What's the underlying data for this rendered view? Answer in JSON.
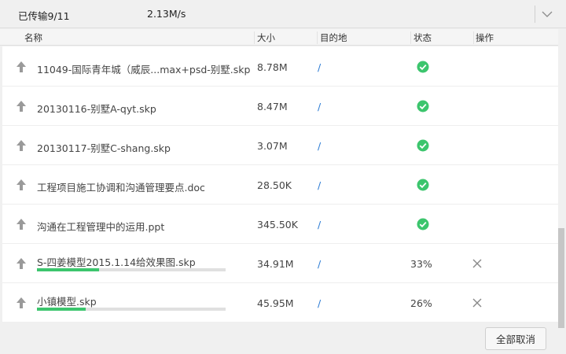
{
  "topbar": {
    "transferred": "已传输9/11",
    "speed": "2.13M/s",
    "collapse_icon": "chevron-down-icon"
  },
  "columns": {
    "name": "名称",
    "size": "大小",
    "destination": "目的地",
    "status": "状态",
    "action": "操作"
  },
  "rows": [
    {
      "name": "11049-国际青年城（威辰...max+psd-别墅.skp",
      "size": "8.78M",
      "dest": "/",
      "status": "done",
      "status_icon": "check-circle-icon"
    },
    {
      "name": "20130116-别墅A-qyt.skp",
      "size": "8.47M",
      "dest": "/",
      "status": "done",
      "status_icon": "check-circle-icon"
    },
    {
      "name": "20130117-别墅C-shang.skp",
      "size": "3.07M",
      "dest": "/",
      "status": "done",
      "status_icon": "check-circle-icon"
    },
    {
      "name": "工程项目施工协调和沟通管理要点.doc",
      "size": "28.50K",
      "dest": "/",
      "status": "done",
      "status_icon": "check-circle-icon"
    },
    {
      "name": "沟通在工程管理中的运用.ppt",
      "size": "345.50K",
      "dest": "/",
      "status": "done",
      "status_icon": "check-circle-icon"
    },
    {
      "name": "S-四姜模型2015.1.14给效果图.skp",
      "size": "34.91M",
      "dest": "/",
      "status": "progress",
      "percent": "33%",
      "progress": 0.33,
      "action_icon": "close-icon"
    },
    {
      "name": "小镇模型.skp",
      "size": "45.95M",
      "dest": "/",
      "status": "progress",
      "percent": "26%",
      "progress": 0.26,
      "action_icon": "close-icon"
    }
  ],
  "footer": {
    "cancel_all": "全部取消"
  },
  "colors": {
    "accent_green": "#3cc56d",
    "dest_blue": "#2a7bd4",
    "arrow_gray": "#9a9a9a"
  }
}
